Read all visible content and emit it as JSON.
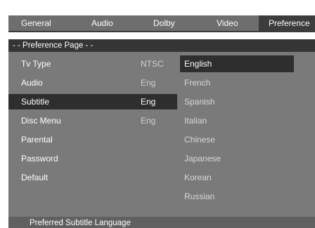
{
  "tabs": [
    {
      "label": "General",
      "active": false
    },
    {
      "label": "Audio",
      "active": false
    },
    {
      "label": "Dolby",
      "active": false
    },
    {
      "label": "Video",
      "active": false
    },
    {
      "label": "Preference",
      "active": true
    }
  ],
  "page_header": "- -  Preference Page  - -",
  "menu": [
    {
      "label": "Tv Type",
      "value": "NTSC"
    },
    {
      "label": "Audio",
      "value": "Eng"
    },
    {
      "label": "Subtitle",
      "value": "Eng",
      "selected": true
    },
    {
      "label": "Disc Menu",
      "value": "Eng"
    },
    {
      "label": "Parental",
      "value": ""
    },
    {
      "label": "Password",
      "value": ""
    },
    {
      "label": "Default",
      "value": ""
    }
  ],
  "options": [
    {
      "label": "English",
      "highlighted": true
    },
    {
      "label": "French"
    },
    {
      "label": "Spanish"
    },
    {
      "label": "Italian"
    },
    {
      "label": "Chinese"
    },
    {
      "label": "Japanese"
    },
    {
      "label": "Korean"
    },
    {
      "label": "Russian"
    }
  ],
  "status_text": "Preferred  Subtitle  Language",
  "colors": {
    "tab_bar": "#6e6e6e",
    "active_tab": "#3c3c3c",
    "panel": "#7a7a7a",
    "header": "#353535",
    "selection": "#2e2e2e",
    "status_bar": "#606060"
  }
}
